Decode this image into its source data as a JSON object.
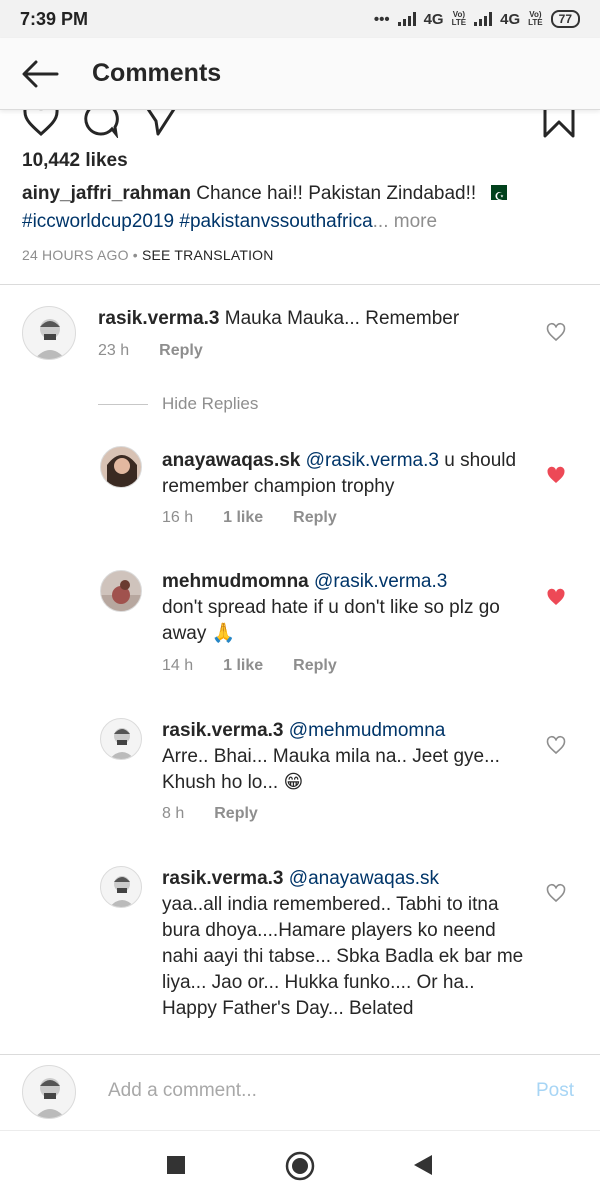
{
  "status": {
    "time": "7:39 PM",
    "net1": "4G",
    "net2": "4G",
    "battery": "77"
  },
  "header": {
    "title": "Comments"
  },
  "post": {
    "likes": "10,442 likes",
    "author": "ainy_jaffri_rahman",
    "caption_text": "Chance hai!! Pakistan Zindabad!!",
    "hashtags": "#iccworldcup2019 #pakistanvssouthafrica",
    "more": "... more",
    "time": "24 HOURS AGO",
    "see_translation": "SEE TRANSLATION"
  },
  "comments": [
    {
      "user": "rasik.verma.3",
      "text": "Mauka Mauka... Remember",
      "time": "23 h",
      "reply": "Reply",
      "liked": false
    },
    {
      "user": "anayawaqas.sk",
      "mention": "@rasik.verma.3",
      "text": "u should remember champion trophy",
      "time": "16 h",
      "likes": "1 like",
      "reply": "Reply",
      "liked": true
    },
    {
      "user": "mehmudmomna",
      "mention": "@rasik.verma.3",
      "text": "don't spread hate if u don't like so plz go away 🙏",
      "time": "14 h",
      "likes": "1 like",
      "reply": "Reply",
      "liked": true
    },
    {
      "user": "rasik.verma.3",
      "mention": "@mehmudmomna",
      "text": "Arre.. Bhai... Mauka mila na.. Jeet gye... Khush ho lo... 😁",
      "time": "8 h",
      "reply": "Reply",
      "liked": false
    },
    {
      "user": "rasik.verma.3",
      "mention": "@anayawaqas.sk",
      "text": "yaa..all india remembered.. Tabhi to itna bura dhoya....Hamare players ko neend nahi aayi thi tabse... Sbka Badla ek bar me liya... Jao or... Hukka funko.... Or ha.. Happy Father's Day... Belated",
      "liked": false
    }
  ],
  "hide_replies": "Hide Replies",
  "add_comment": {
    "placeholder": "Add a comment...",
    "post": "Post"
  },
  "colors": {
    "accent_link": "#003569",
    "like_red": "#ed4956",
    "post_disabled": "#a7d5f5"
  }
}
